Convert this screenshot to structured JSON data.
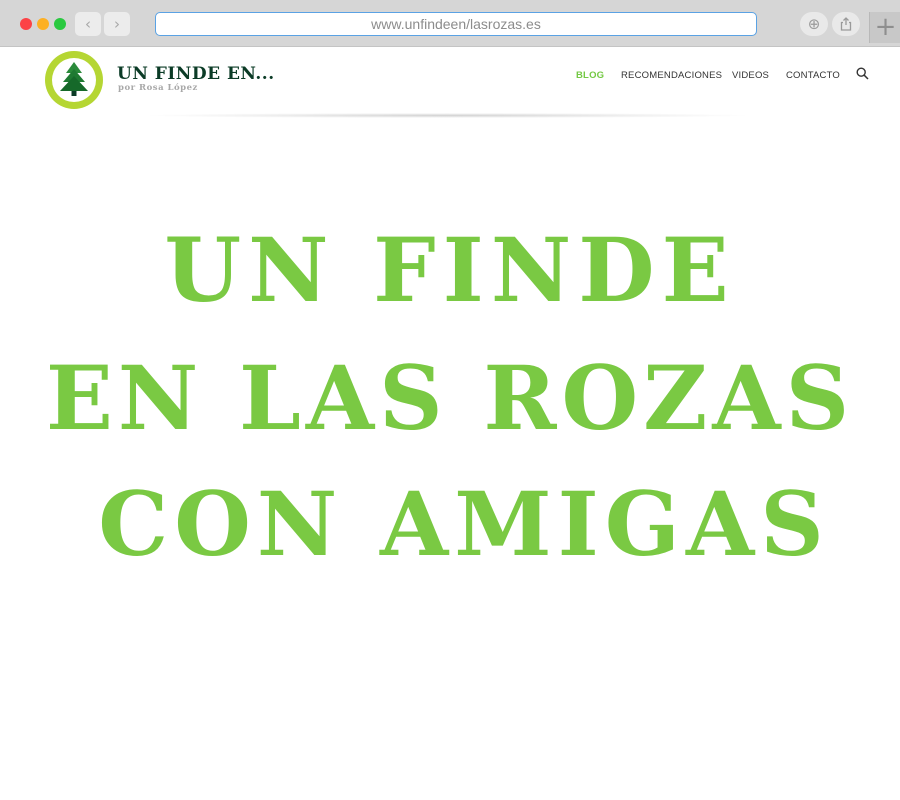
{
  "browser": {
    "url": "www.unfindeen/lasrozas.es",
    "back_icon": "chevron-left-icon",
    "forward_icon": "chevron-right-icon",
    "add_icon": "plus-circle-icon",
    "share_icon": "share-icon",
    "new_tab_icon": "plus-icon"
  },
  "header": {
    "brand_title": "UN FINDE EN...",
    "brand_subtitle": "por Rosa López",
    "logo_icon": "pine-tree-icon",
    "nav": [
      {
        "label": "BLOG",
        "active": true
      },
      {
        "label": "RECOMENDACIONES",
        "active": false
      },
      {
        "label": "VIDEOS",
        "active": false
      },
      {
        "label": "CONTACTO",
        "active": false
      }
    ],
    "search_icon": "search-icon"
  },
  "hero": {
    "lines": [
      "UN FINDE",
      "EN LAS ROZAS",
      "CON AMIGAS"
    ]
  },
  "colors": {
    "accent": "#7ac943",
    "brand_dark": "#0b3b26",
    "logo_ring": "#b5d633"
  }
}
